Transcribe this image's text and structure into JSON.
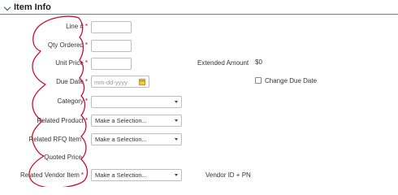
{
  "section": {
    "title": "Item Info"
  },
  "fields": {
    "line_no": {
      "label": "Line #",
      "required": "*",
      "value": ""
    },
    "qty_ordered": {
      "label": "Qty Ordered",
      "required": "*",
      "value": ""
    },
    "unit_price": {
      "label": "Unit Price",
      "required": "*",
      "value": ""
    },
    "due_date": {
      "label": "Due Date",
      "required": "*",
      "placeholder": "mm-dd-yyyy"
    },
    "category": {
      "label": "Category",
      "required": "*",
      "value": ""
    },
    "related_product": {
      "label": "Related Product",
      "required": "*",
      "value": "Make a Selection..."
    },
    "related_rfq_item": {
      "label": "Related RFQ Item",
      "value": "Make a Selection..."
    },
    "quoted_price": {
      "label": "Quoted Price"
    },
    "related_vendor_item": {
      "label": "Related Vendor Item",
      "required": "*",
      "value": "Make a Selection..."
    }
  },
  "extended_amount": {
    "label": "Extended Amount",
    "value": "$0"
  },
  "change_due_date": {
    "label": "Change Due Date",
    "checked": false
  },
  "vendor_id_pn": {
    "label": "Vendor ID + PN"
  },
  "colors": {
    "required": "#d0021b",
    "annotation": "#c8102e",
    "rule": "#6a7f92"
  },
  "icons": [
    "chevron-down-icon",
    "calendar-icon"
  ]
}
